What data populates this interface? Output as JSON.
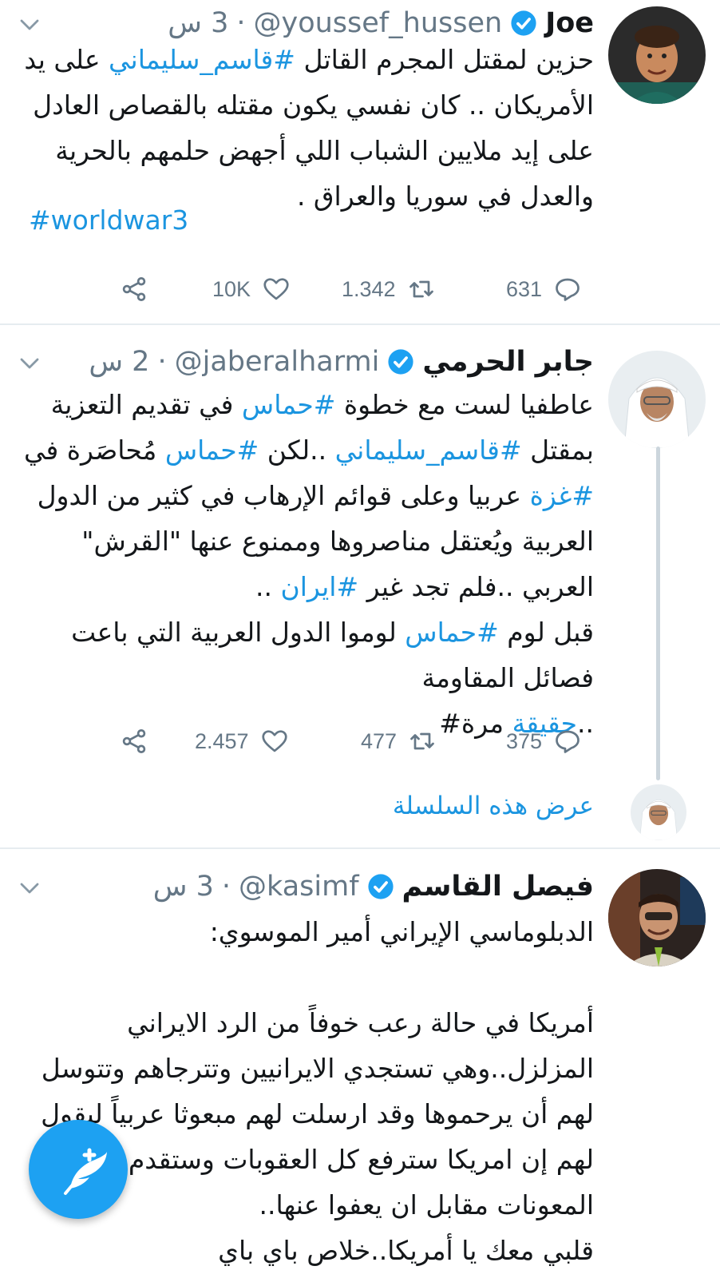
{
  "tweets": [
    {
      "name": "Joe",
      "handle": "@youssef_hussen",
      "separator": "·",
      "time": "3 س",
      "lines": [
        [
          "حزين لمقتل المجرم القاتل ",
          {
            "tag": "#قاسم_سليماني"
          },
          " على يد"
        ],
        [
          "الأمريكان .. كان نفسي يكون مقتله بالقصاص العادل"
        ],
        [
          "على إيد ملايين الشباب اللي أجهض حلمهم بالحرية"
        ],
        [
          "والعدل في سوريا والعراق ."
        ]
      ],
      "ltr_tag": "#worldwar3",
      "replies": "631",
      "retweets": "1.342",
      "likes": "10K"
    },
    {
      "name": "جابر الحرمي",
      "handle": "@jaberalharmi",
      "separator": "·",
      "time": "2 س",
      "lines": [
        [
          "عاطفيا لست مع خطوة ",
          {
            "tag": "#حماس"
          },
          " في تقديم التعزية"
        ],
        [
          "بمقتل ",
          {
            "tag": "#قاسم_سليماني"
          },
          " ..لكن ",
          {
            "tag": "#حماس"
          },
          " مُحاصَرة في"
        ],
        [
          {
            "tag": "#غزة"
          },
          " عربيا وعلى قوائم الإرهاب في كثير من الدول"
        ],
        [
          "العربية ويُعتقل مناصروها وممنوع عنها \"القرش\""
        ],
        [
          "العربي ..فلم تجد غير ",
          {
            "tag": "#ايران"
          },
          " .."
        ],
        [
          "قبل لوم ",
          {
            "tag": "#حماس"
          },
          " لوموا الدول العربية التي باعت"
        ],
        [
          "فصائل المقاومة"
        ],
        [
          "..",
          {
            "tag": "حقيقة"
          },
          " مرة#"
        ]
      ],
      "replies": "375",
      "retweets": "477",
      "likes": "2.457",
      "show_thread": "عرض هذه السلسلة"
    },
    {
      "name": "فيصل القاسم",
      "handle": "@kasimf",
      "separator": "·",
      "time": "3 س",
      "lines": [
        [
          "الدبلوماسي الإيراني أمير الموسوي:"
        ],
        [
          ""
        ],
        [
          "أمريكا في حالة رعب خوفاً من الرد الايراني"
        ],
        [
          "المزلزل..وهي تستجدي الايرانيين وتترجاهم وتتوسل"
        ],
        [
          "لهم أن يرحموها وقد ارسلت لهم مبعوثا عربياً ليقول"
        ],
        [
          "لهم إن امريكا سترفع كل العقوبات وستقدم لهم"
        ],
        [
          "المعونات مقابل ان يعفوا عنها.."
        ],
        [
          "قلبي معك يا أمريكا..خلاص باي باي"
        ]
      ]
    }
  ],
  "icons": {
    "verified": "verified-badge-icon",
    "caret": "chevron-down-icon",
    "reply": "reply-icon",
    "retweet": "retweet-icon",
    "like": "heart-icon",
    "share": "share-icon",
    "compose": "compose-tweet-icon"
  },
  "colors": {
    "link": "#1b95e0",
    "secondary": "#657786",
    "fab": "#1da1f2"
  }
}
